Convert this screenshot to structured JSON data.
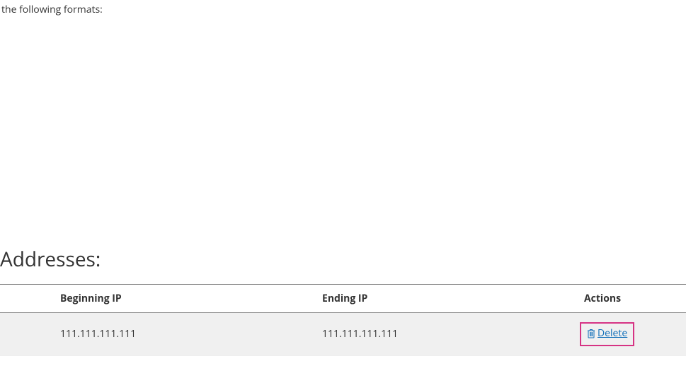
{
  "intro": {
    "fragment": "the following formats:"
  },
  "section": {
    "heading": "Addresses:"
  },
  "table": {
    "headers": {
      "beginning": "Beginning IP",
      "ending": "Ending IP",
      "actions": "Actions"
    },
    "rows": [
      {
        "beginning_ip": "111.111.111.111",
        "ending_ip": "111.111.111.111",
        "delete_label": "Delete"
      }
    ]
  },
  "colors": {
    "link": "#0d6db8",
    "highlight_box": "#d63384",
    "row_bg": "#f0f0f0"
  }
}
